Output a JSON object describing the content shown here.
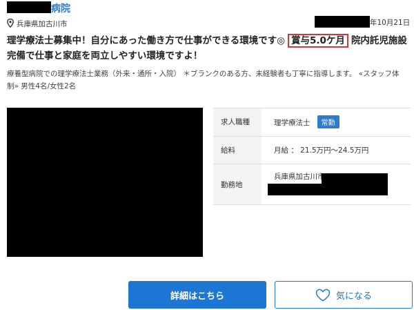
{
  "listing": {
    "hospital_name_suffix": "病院",
    "location": "兵庫県加古川市",
    "date_suffix": "年10月21日",
    "title_before": "理学療法士募集中！自分にあった働き方で仕事ができる環境です◎",
    "bonus_badge": "賞与5.0ケ月",
    "title_after": "院内託児施設完備で仕事と家庭を両立しやすい環境ですよ！",
    "description": "療養型病院での理学療法士業務（外来・通所・入院） ＊ブランクのある方、未経験者も丁寧に指導します。 «スタッフ体制» 男性4名/女性2名"
  },
  "info_table": {
    "job_type_label": "求人職種",
    "job_type_value": "理学療法士",
    "employment_tag": "常勤",
    "salary_label": "給料",
    "salary_value": "月給 ： 21.5万円〜24.5万円",
    "workplace_label": "勤務地",
    "workplace_value": "兵庫県加古川市"
  },
  "buttons": {
    "detail_label": "詳細はこちら",
    "favorite_label": "気になる"
  },
  "icons": {
    "location": "map-pin-icon",
    "favorite": "heart-icon"
  },
  "colors": {
    "link_blue": "#2a7dd1",
    "button_blue": "#1d76d3",
    "badge_border_red": "#e03030"
  }
}
